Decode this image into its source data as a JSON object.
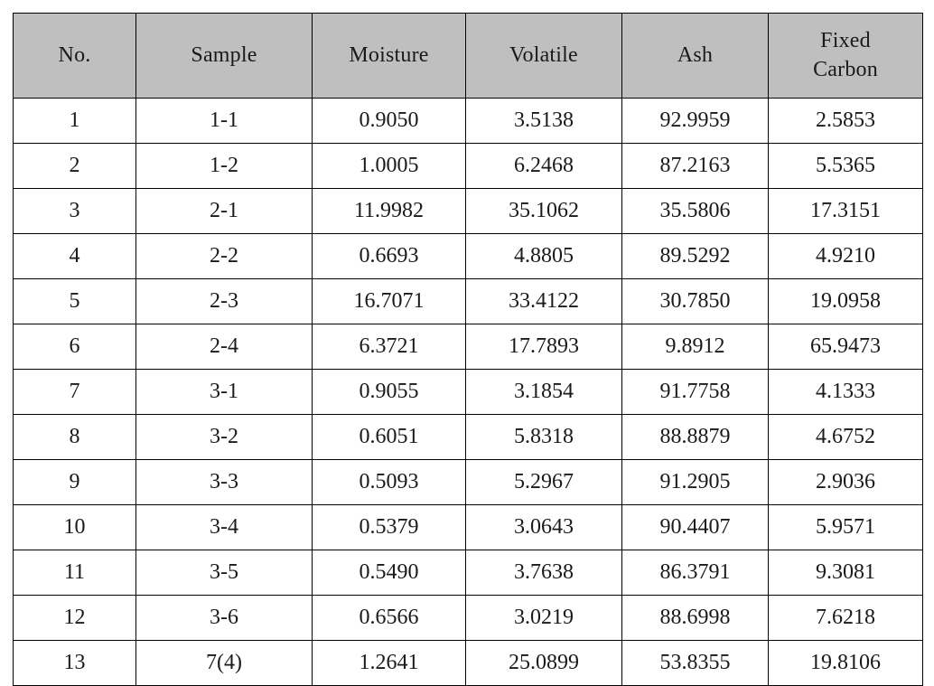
{
  "table": {
    "name": "proximate-analysis-table",
    "header_background": "#bfbfbf",
    "border_color": "#000000",
    "columns": [
      {
        "key": "no",
        "label": "No."
      },
      {
        "key": "sample",
        "label": "Sample"
      },
      {
        "key": "moisture",
        "label": "Moisture"
      },
      {
        "key": "volatile",
        "label": "Volatile"
      },
      {
        "key": "ash",
        "label": "Ash"
      },
      {
        "key": "fixed_carbon",
        "label": "Fixed Carbon",
        "label_line1": "Fixed",
        "label_line2": "Carbon"
      }
    ],
    "rows": [
      {
        "no": "1",
        "sample": "1-1",
        "moisture": "0.9050",
        "volatile": "3.5138",
        "ash": "92.9959",
        "fixed_carbon": "2.5853"
      },
      {
        "no": "2",
        "sample": "1-2",
        "moisture": "1.0005",
        "volatile": "6.2468",
        "ash": "87.2163",
        "fixed_carbon": "5.5365"
      },
      {
        "no": "3",
        "sample": "2-1",
        "moisture": "11.9982",
        "volatile": "35.1062",
        "ash": "35.5806",
        "fixed_carbon": "17.3151"
      },
      {
        "no": "4",
        "sample": "2-2",
        "moisture": "0.6693",
        "volatile": "4.8805",
        "ash": "89.5292",
        "fixed_carbon": "4.9210"
      },
      {
        "no": "5",
        "sample": "2-3",
        "moisture": "16.7071",
        "volatile": "33.4122",
        "ash": "30.7850",
        "fixed_carbon": "19.0958"
      },
      {
        "no": "6",
        "sample": "2-4",
        "moisture": "6.3721",
        "volatile": "17.7893",
        "ash": "9.8912",
        "fixed_carbon": "65.9473"
      },
      {
        "no": "7",
        "sample": "3-1",
        "moisture": "0.9055",
        "volatile": "3.1854",
        "ash": "91.7758",
        "fixed_carbon": "4.1333"
      },
      {
        "no": "8",
        "sample": "3-2",
        "moisture": "0.6051",
        "volatile": "5.8318",
        "ash": "88.8879",
        "fixed_carbon": "4.6752"
      },
      {
        "no": "9",
        "sample": "3-3",
        "moisture": "0.5093",
        "volatile": "5.2967",
        "ash": "91.2905",
        "fixed_carbon": "2.9036"
      },
      {
        "no": "10",
        "sample": "3-4",
        "moisture": "0.5379",
        "volatile": "3.0643",
        "ash": "90.4407",
        "fixed_carbon": "5.9571"
      },
      {
        "no": "11",
        "sample": "3-5",
        "moisture": "0.5490",
        "volatile": "3.7638",
        "ash": "86.3791",
        "fixed_carbon": "9.3081"
      },
      {
        "no": "12",
        "sample": "3-6",
        "moisture": "0.6566",
        "volatile": "3.0219",
        "ash": "88.6998",
        "fixed_carbon": "7.6218"
      },
      {
        "no": "13",
        "sample": "7(4)",
        "moisture": "1.2641",
        "volatile": "25.0899",
        "ash": "53.8355",
        "fixed_carbon": "19.8106"
      }
    ]
  }
}
